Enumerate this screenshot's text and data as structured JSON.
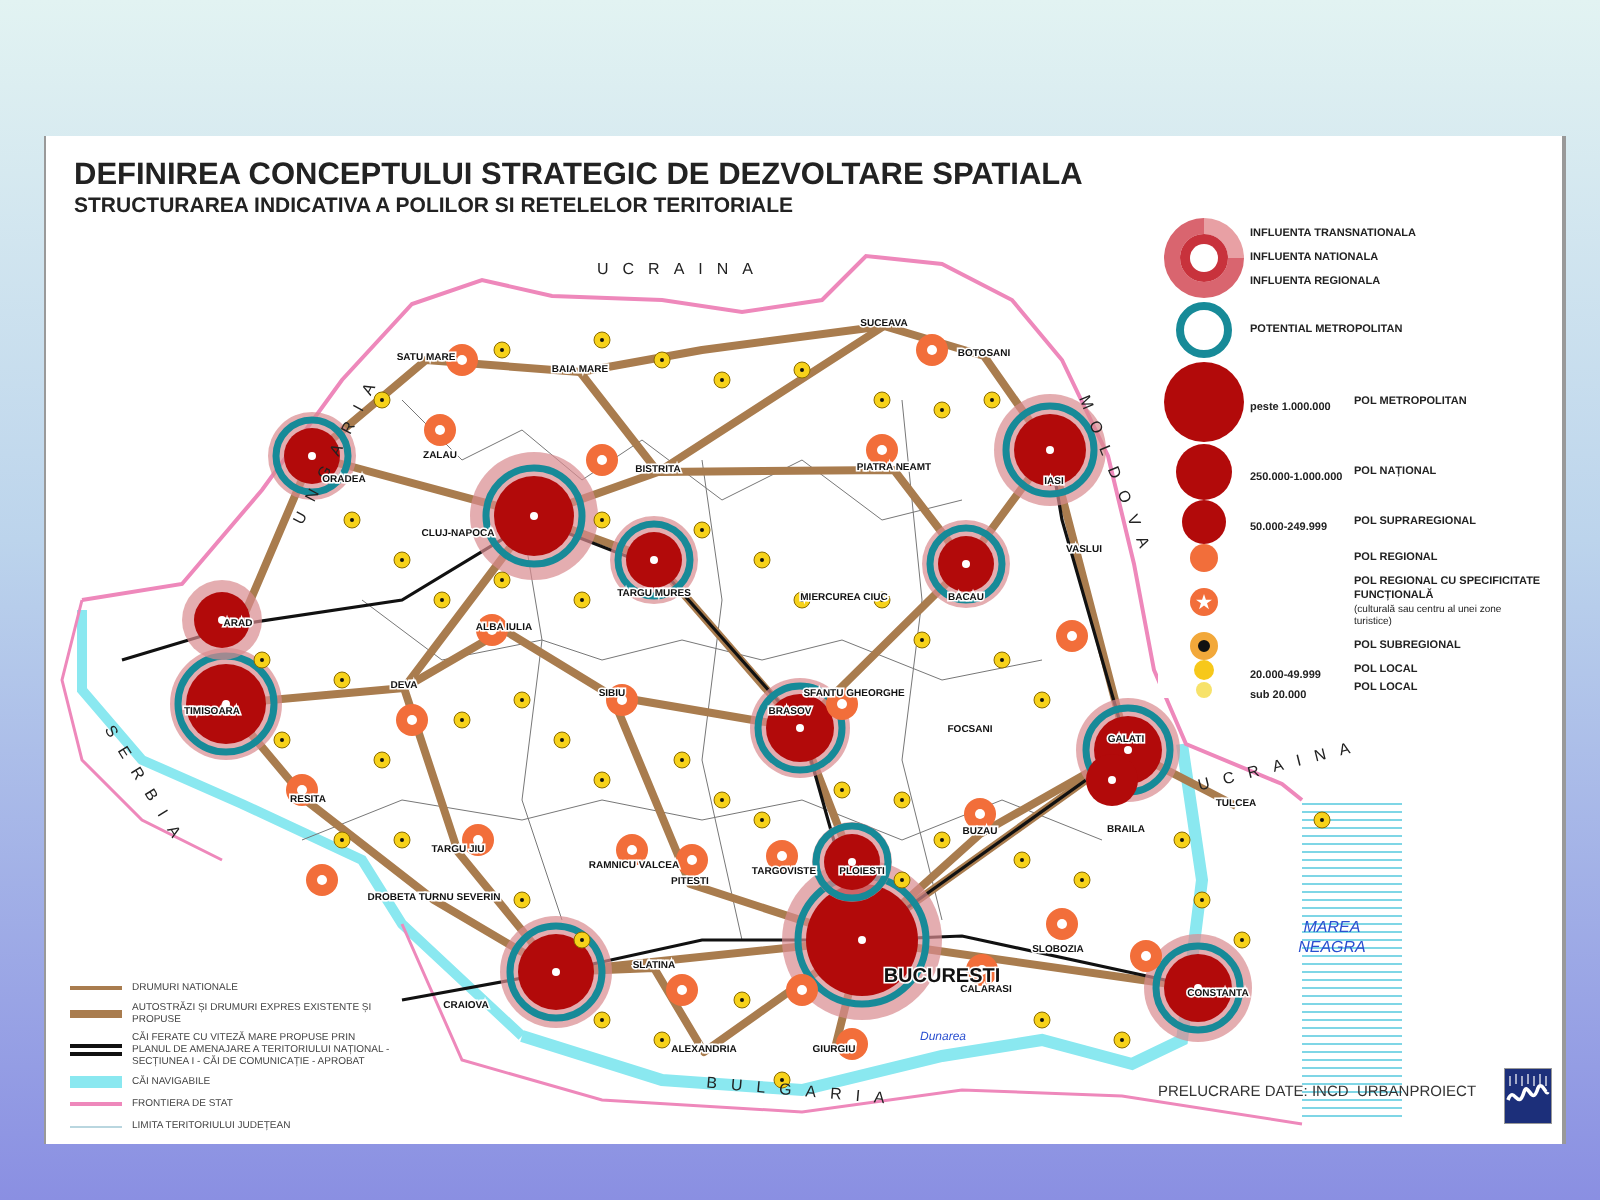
{
  "title": "DEFINIREA CONCEPTULUI STRATEGIC DE DEZVOLTARE SPATIALA",
  "subtitle": "STRUCTURAREA INDICATIVA A POLILOR SI RETELELOR TERITORIALE",
  "map": {
    "countries": [
      "UCRAINA",
      "UNGARIA",
      "SERBIA",
      "BULGARIA",
      "MOLDOVA",
      "UCRAINA"
    ],
    "cities": [
      {
        "name": "SATU MARE",
        "major": false
      },
      {
        "name": "BAIA MARE",
        "major": false
      },
      {
        "name": "SUCEAVA",
        "major": false
      },
      {
        "name": "BOTOSANI",
        "major": false
      },
      {
        "name": "IASI",
        "major": false
      },
      {
        "name": "ORADEA",
        "major": false
      },
      {
        "name": "ZALAU",
        "major": false
      },
      {
        "name": "CLUJ-NAPOCA",
        "major": false
      },
      {
        "name": "BISTRITA",
        "major": false
      },
      {
        "name": "PIATRA NEAMT",
        "major": false
      },
      {
        "name": "TARGU MURES",
        "major": false
      },
      {
        "name": "BACAU",
        "major": false
      },
      {
        "name": "VASLUI",
        "major": false
      },
      {
        "name": "MIERCUREA CIUC",
        "major": false
      },
      {
        "name": "ARAD",
        "major": false
      },
      {
        "name": "ALBA IULIA",
        "major": false
      },
      {
        "name": "TIMISOARA",
        "major": false
      },
      {
        "name": "DEVA",
        "major": false
      },
      {
        "name": "SIBIU",
        "major": false
      },
      {
        "name": "BRASOV",
        "major": false
      },
      {
        "name": "SFANTU GHEORGHE",
        "major": false
      },
      {
        "name": "FOCSANI",
        "major": false
      },
      {
        "name": "GALATI",
        "major": false
      },
      {
        "name": "BRAILA",
        "major": false
      },
      {
        "name": "BUZAU",
        "major": false
      },
      {
        "name": "RESITA",
        "major": false
      },
      {
        "name": "TARGU JIU",
        "major": false
      },
      {
        "name": "RAMNICU VALCEA",
        "major": false
      },
      {
        "name": "PITESTI",
        "major": false
      },
      {
        "name": "TARGOVISTE",
        "major": false
      },
      {
        "name": "PLOIESTI",
        "major": false
      },
      {
        "name": "DROBETA TURNU SEVERIN",
        "major": false
      },
      {
        "name": "CRAIOVA",
        "major": false
      },
      {
        "name": "SLATINA",
        "major": false
      },
      {
        "name": "BUCURESTI",
        "major": true
      },
      {
        "name": "SLOBOZIA",
        "major": false
      },
      {
        "name": "CALARASI",
        "major": false
      },
      {
        "name": "ALEXANDRIA",
        "major": false
      },
      {
        "name": "GIURGIU",
        "major": false
      },
      {
        "name": "TULCEA",
        "major": false
      },
      {
        "name": "CONSTANTA",
        "major": false
      }
    ],
    "river": "Dunarea",
    "sea": [
      "MAREA",
      "NEAGRA"
    ]
  },
  "pole_legend": [
    {
      "kind": "influence",
      "labels": [
        "INFLUENTA TRANSNATIONALA",
        "INFLUENTA NATIONALA",
        "INFLUENTA REGIONALA"
      ]
    },
    {
      "kind": "metropolitan_ring",
      "labels": [
        "POTENTIAL METROPOLITAN"
      ]
    },
    {
      "kind": "pole_metropolitan",
      "range": "peste 1.000.000",
      "labels": [
        "POL METROPOLITAN"
      ]
    },
    {
      "kind": "pole_national",
      "range": "250.000-1.000.000",
      "labels": [
        "POL NAȚIONAL"
      ]
    },
    {
      "kind": "pole_supraregional",
      "range": "50.000-249.999",
      "labels": [
        "POL SUPRAREGIONAL"
      ]
    },
    {
      "kind": "pole_regional",
      "labels": [
        "POL REGIONAL"
      ]
    },
    {
      "kind": "pole_regional_star",
      "labels": [
        "POL REGIONAL CU SPECIFICITATE FUNCȚIONALĂ"
      ],
      "note": "(culturală sau centru al unei zone turistice)"
    },
    {
      "kind": "pole_subregional",
      "labels": [
        "POL SUBREGIONAL"
      ]
    },
    {
      "kind": "pole_local_large",
      "range": "20.000-49.999",
      "labels": [
        "POL LOCAL"
      ]
    },
    {
      "kind": "pole_local_small",
      "range": "sub 20.000",
      "labels": [
        "POL LOCAL"
      ]
    }
  ],
  "network_legend": [
    {
      "kind": "road_national",
      "label": "DRUMURI NATIONALE"
    },
    {
      "kind": "expressway",
      "label": "AUTOSTRĂZI ȘI DRUMURI EXPRES EXISTENTE ȘI PROPUSE"
    },
    {
      "kind": "rail",
      "label": "CĂI FERATE CU VITEZĂ MARE PROPUSE PRIN PLANUL DE AMENAJARE A TERITORIULUI NAȚIONAL - SECȚIUNEA I - CĂI DE COMUNICAȚIE - APROBAT"
    },
    {
      "kind": "waterway",
      "label": "CĂI NAVIGABILE"
    },
    {
      "kind": "border",
      "label": "FRONTIERA DE STAT"
    },
    {
      "kind": "county_limit",
      "label": "LIMITA TERITORIULUI JUDEȚEAN"
    }
  ],
  "credit": "PRELUCRARE DATE: INCD  URBANPROIECT"
}
